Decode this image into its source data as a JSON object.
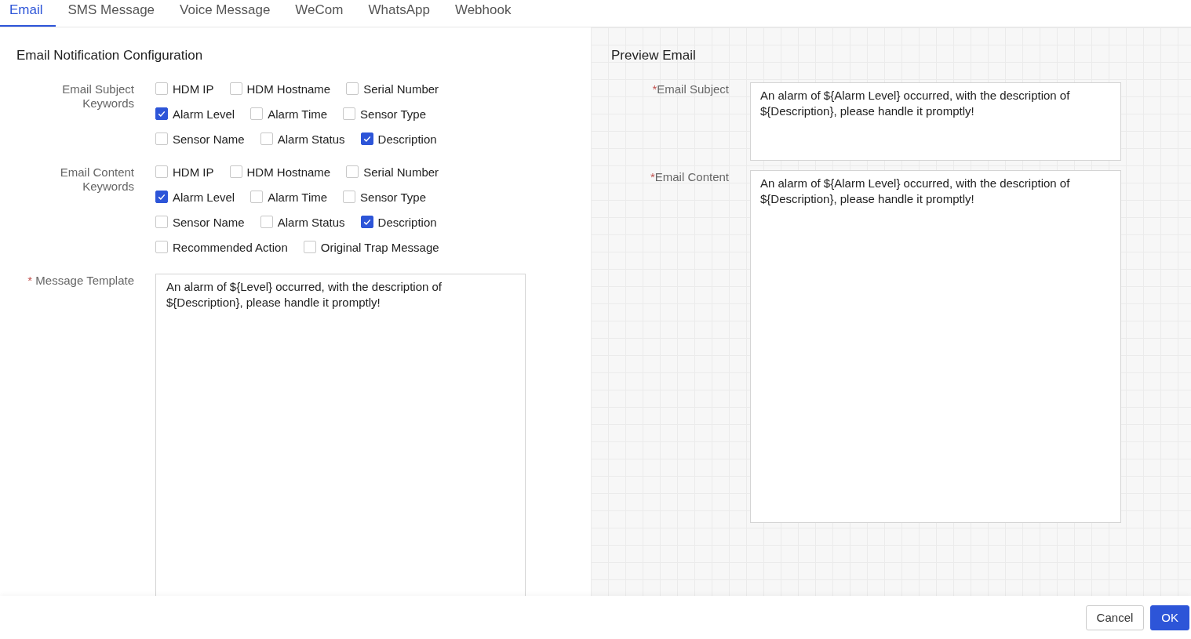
{
  "tabs": [
    {
      "label": "Email",
      "selected": true
    },
    {
      "label": "SMS Message",
      "selected": false
    },
    {
      "label": "Voice Message",
      "selected": false
    },
    {
      "label": "WeCom",
      "selected": false
    },
    {
      "label": "WhatsApp",
      "selected": false
    },
    {
      "label": "Webhook",
      "selected": false
    }
  ],
  "config": {
    "title": "Email Notification Configuration",
    "keyword_groups": [
      {
        "label": "Email Subject Keywords",
        "rows": [
          [
            {
              "label": "HDM IP",
              "checked": false
            },
            {
              "label": "HDM Hostname",
              "checked": false
            },
            {
              "label": "Serial Number",
              "checked": false
            }
          ],
          [
            {
              "label": "Alarm Level",
              "checked": true
            },
            {
              "label": "Alarm Time",
              "checked": false
            },
            {
              "label": "Sensor Type",
              "checked": false
            }
          ],
          [
            {
              "label": "Sensor Name",
              "checked": false
            },
            {
              "label": "Alarm Status",
              "checked": false
            },
            {
              "label": "Description",
              "checked": true
            }
          ]
        ]
      },
      {
        "label": "Email Content Keywords",
        "rows": [
          [
            {
              "label": "HDM IP",
              "checked": false
            },
            {
              "label": "HDM Hostname",
              "checked": false
            },
            {
              "label": "Serial Number",
              "checked": false
            }
          ],
          [
            {
              "label": "Alarm Level",
              "checked": true
            },
            {
              "label": "Alarm Time",
              "checked": false
            },
            {
              "label": "Sensor Type",
              "checked": false
            }
          ],
          [
            {
              "label": "Sensor Name",
              "checked": false
            },
            {
              "label": "Alarm Status",
              "checked": false
            },
            {
              "label": "Description",
              "checked": true
            }
          ],
          [
            {
              "label": "Recommended Action",
              "checked": false
            },
            {
              "label": "Original Trap Message",
              "checked": false
            }
          ]
        ]
      }
    ],
    "template": {
      "required_mark": "*",
      "label": "Message Template",
      "value": "An alarm of ${Level} occurred, with the description of ${Description}, please handle it promptly!"
    }
  },
  "preview": {
    "title": "Preview Email",
    "fields": [
      {
        "required_mark": "*",
        "label": "Email Subject",
        "value": "An alarm of ${Alarm Level} occurred, with the description of ${Description}, please handle it promptly!",
        "kind": "short"
      },
      {
        "required_mark": "*",
        "label": "Email Content",
        "value": "An alarm of ${Alarm Level} occurred, with the description of ${Description}, please handle it promptly!",
        "kind": "tall"
      }
    ]
  },
  "buttons": {
    "cancel": "Cancel",
    "ok": "OK"
  }
}
